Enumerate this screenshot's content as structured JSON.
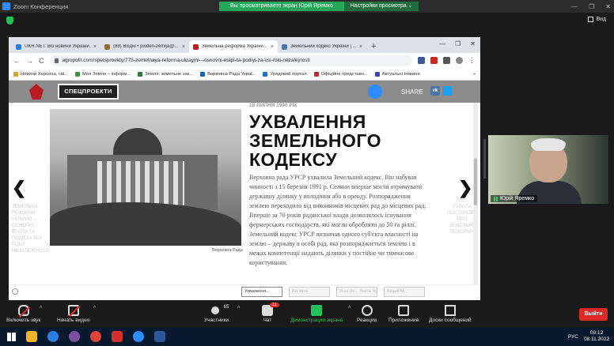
{
  "zoom": {
    "window_title": "Zoom Конференция",
    "banner_text": "Вы просматриваете экран Юрій Яремко",
    "view_options_label": "Настройки просмотра ⌄",
    "view_label": "Вид",
    "win_min": "—",
    "win_max": "❐",
    "win_close": "✕"
  },
  "browser": {
    "tabs": [
      {
        "label": "UKR.NET: Всі новини України...",
        "color": "#2a7de1",
        "active": false
      },
      {
        "label": "(88) Вхідні • pivden-zemlja@...",
        "color": "#8a6d3b",
        "active": false
      },
      {
        "label": "Земельна реформа України...",
        "color": "#b81c24",
        "active": true
      },
      {
        "label": "Земельний кодекс України | ...",
        "color": "#4a76a8",
        "active": false
      }
    ],
    "new_tab": "+",
    "tab_close": "×",
    "ctrl_min": "—",
    "ctrl_max": "❐",
    "ctrl_close": "✕",
    "nav_back": "←",
    "nav_forward": "→",
    "nav_reload": "C",
    "url": "agropolit.com/spetsproekty/775-zemelnaya-reforma-ukrayini---osnovni-etapi-ta-podiyi-za-vsi-roki-nezalejnosti",
    "menu": "⋮",
    "bookmarks": [
      {
        "label": "Новини Херсона, сві...",
        "color": "#e0a020"
      },
      {
        "label": "Моя Земля – інформ...",
        "color": "#3a9a3a"
      },
      {
        "label": "Земля: земельне зак...",
        "color": "#2e7d32"
      },
      {
        "label": "Верховна Рада Украї...",
        "color": "#1565c0"
      },
      {
        "label": "Урядовий портал",
        "color": "#1976d2"
      },
      {
        "label": "Офіційне представн...",
        "color": "#c62828"
      },
      {
        "label": "Актуальні Новини",
        "color": "#3949ab"
      }
    ],
    "bookmarks_more": "»"
  },
  "site": {
    "spec_button": "СПЕЦПРОЕКТИ",
    "share_label": "SHARE",
    "vk_label": "vk",
    "date": "18 ЛИПНЯ 1990 РІК",
    "headline": "УХВАЛЕННЯ ЗЕМЕЛЬНОГО КОДЕКСУ",
    "body": "Верховна рада УРСР ухвалила Земельний кодекс. Він набував чинності з 15 березня 1991 р. Селяни вперше могли отримувати державну ділянку у володіння або в оренду. Розпорядження землею переходило від виконкомів місцевих рад до місцевих рад. Вперше за 70 років радянської влади дозволялось існування фермерських господарств, які могли обробляти до 50 га ріллі. Земельний кодекс УРСР визначав одного суб'єкта власності на землю – державу в особі рад, яка розпоряджається землею і в межах компетенції надають ділянки у постійне чи тимчасове користування.",
    "photo_caption": "Верховна Рада",
    "arrow_prev": "❮",
    "arrow_next": "❯",
    "prev_side": "ЗЕМЕЛЬНА РЕФОРМА УКРАЇНИ – ОСНОВНІ ЕТАПИ ТА ПОДІЇ ЗА ВСІ РОКИ НЕЗАЛЕЖНОСТІ",
    "next_side": "УХВАЛА ПОСТАНОВИ ПРО ЗЕМЕЛЬНУ РЕФОРМУ",
    "thumbs": [
      {
        "label": "Ухвалення...",
        "active": true
      },
      {
        "label": "Вті Указ",
        "active": false
      },
      {
        "label": "Указ Ле... Закон Куч...",
        "active": false
      },
      {
        "label": "Віщий М...",
        "active": false
      }
    ]
  },
  "participant": {
    "name": "Юрій Яремко"
  },
  "toolbar": {
    "mute": "Включить звук",
    "video": "Начать видео",
    "participants": "Участники",
    "participants_count": "65",
    "chat": "Чат",
    "chat_badge": "11",
    "share": "Демонстрация экрана",
    "reactions": "Реакции",
    "apps": "Приложения",
    "whiteboard": "Доски сообщений",
    "leave": "Выйти",
    "caret": "^"
  },
  "taskbar": {
    "apps": [
      {
        "name": "explorer",
        "color": "#f0b429"
      },
      {
        "name": "edge",
        "color": "#2a7de1"
      },
      {
        "name": "viber",
        "color": "#7b519d"
      },
      {
        "name": "chrome",
        "color": "#db4437"
      },
      {
        "name": "acrobat",
        "color": "#d32f2f"
      },
      {
        "name": "zoom",
        "color": "#2d8cff"
      },
      {
        "name": "word",
        "color": "#2b579a"
      }
    ],
    "lang": "РУС",
    "time": "09:12",
    "date": "08.11.2022"
  }
}
